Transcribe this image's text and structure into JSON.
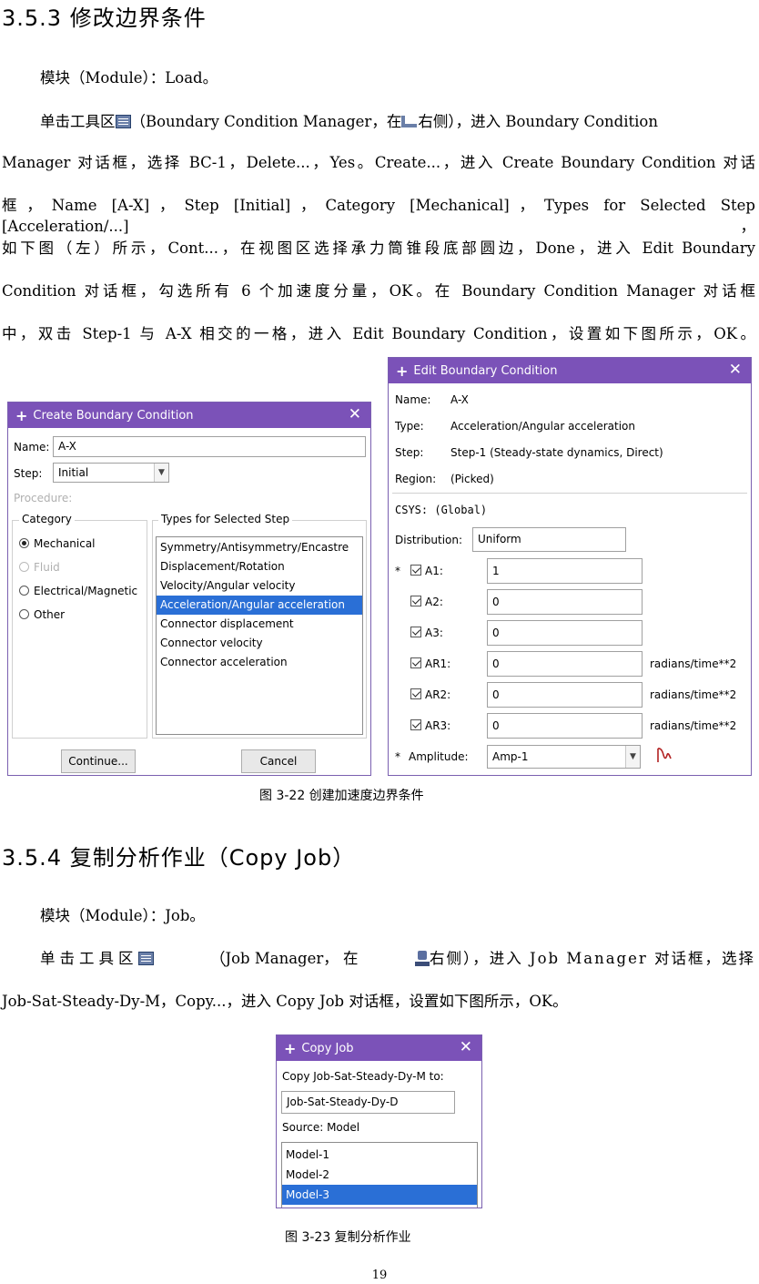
{
  "sec353": {
    "heading": "3.5.3 修改边界条件",
    "module_line": "模块（Module）：Load。",
    "p1_a": "单击工具区",
    "p1_b": "（Boundary Condition Manager，在",
    "p1_c": "右侧），进入 Boundary Condition",
    "p1_line2": "Manager 对话框，选择 BC-1，Delete...，Yes。Create...，进入 Create Boundary Condition 对话",
    "p1_line3": "框，Name [A-X]，Step [Initial]，Category [Mechanical]，Types for Selected Step [Acceleration/...]，",
    "p1_line4": "如下图（左）所示，Cont...，在视图区选择承力筒锥段底部圆边，Done，进入 Edit Boundary",
    "p1_line5": "Condition 对话框，勾选所有 6 个加速度分量，OK。在 Boundary Condition Manager 对话框",
    "p1_line6": "中，双击 Step-1 与 A-X 相交的一格，进入 Edit Boundary Condition，设置如下图所示，OK。"
  },
  "create_bc": {
    "title": "Create Boundary Condition",
    "name_label": "Name:",
    "name_value": "A-X",
    "step_label": "Step:",
    "step_value": "Initial",
    "procedure_label": "Procedure:",
    "category_label": "Category",
    "categories": [
      "Mechanical",
      "Fluid",
      "Electrical/Magnetic",
      "Other"
    ],
    "types_label": "Types for Selected Step",
    "types": [
      "Symmetry/Antisymmetry/Encastre",
      "Displacement/Rotation",
      "Velocity/Angular velocity",
      "Acceleration/Angular acceleration",
      "Connector displacement",
      "Connector velocity",
      "Connector acceleration"
    ],
    "continue_label": "Continue...",
    "cancel_label": "Cancel"
  },
  "edit_bc": {
    "title": "Edit Boundary Condition",
    "name_label": "Name:",
    "name_value": "A-X",
    "type_label": "Type:",
    "type_value": "Acceleration/Angular acceleration",
    "step_label": "Step:",
    "step_value": "Step-1 (Steady-state dynamics, Direct)",
    "region_label": "Region:",
    "region_value": "(Picked)",
    "csys_text": "CSYS: (Global)",
    "distribution_label": "Distribution:",
    "distribution_value": "Uniform",
    "components": [
      {
        "star": "*",
        "label": "A1:",
        "value": "1",
        "unit": ""
      },
      {
        "star": "",
        "label": "A2:",
        "value": "0",
        "unit": ""
      },
      {
        "star": "",
        "label": "A3:",
        "value": "0",
        "unit": ""
      },
      {
        "star": "",
        "label": "AR1:",
        "value": "0",
        "unit": "radians/time**2"
      },
      {
        "star": "",
        "label": "AR2:",
        "value": "0",
        "unit": "radians/time**2"
      },
      {
        "star": "",
        "label": "AR3:",
        "value": "0",
        "unit": "radians/time**2"
      }
    ],
    "amplitude_star": "*",
    "amplitude_label": "Amplitude:",
    "amplitude_value": "Amp-1"
  },
  "fig322_caption": "图 3-22  创建加速度边界条件",
  "sec354": {
    "heading": "3.5.4 复制分析作业（Copy Job）",
    "module_line": "模块（Module）：Job。",
    "p1_a": "单击工具区",
    "p1_b": "（Job Manager， 在",
    "p1_c": "右侧），进入 Job Manager 对话框，选择",
    "p1_line2": "Job-Sat-Steady-Dy-M，Copy...，进入 Copy Job 对话框，设置如下图所示，OK。"
  },
  "copy_job": {
    "title": "Copy Job",
    "copy_label": "Copy Job-Sat-Steady-Dy-M to:",
    "new_name": "Job-Sat-Steady-Dy-D",
    "source_label": "Source:  Model",
    "models": [
      "Model-1",
      "Model-2",
      "Model-3"
    ]
  },
  "fig323_caption": "图 3-23  复制分析作业",
  "page_number": "19"
}
